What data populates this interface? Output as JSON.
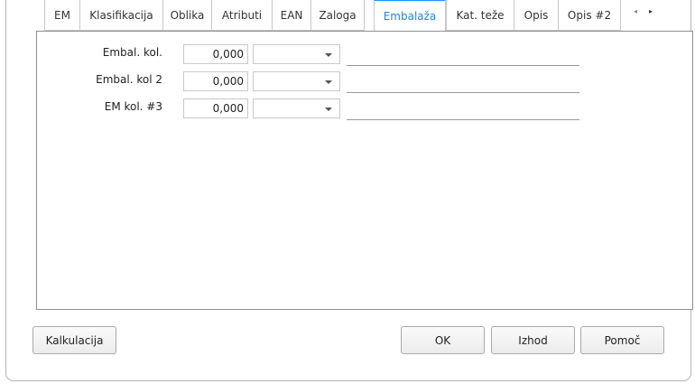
{
  "tabs": [
    {
      "label": "EM"
    },
    {
      "label": "Klasifikacija"
    },
    {
      "label": "Oblika"
    },
    {
      "label": "Atributi"
    },
    {
      "label": "EAN"
    },
    {
      "label": "Zaloga"
    },
    {
      "label": "Embalaža",
      "active": true
    },
    {
      "label": "Kat. teže"
    },
    {
      "label": "Opis"
    },
    {
      "label": "Opis #2"
    }
  ],
  "tab_scroll": {
    "left": "◂",
    "right": "▸"
  },
  "fields": [
    {
      "label": "Embal. kol.",
      "value": "0,000",
      "unit": ""
    },
    {
      "label": "Embal. kol 2",
      "value": "0,000",
      "unit": ""
    },
    {
      "label": "EM kol. #3",
      "value": "0,000",
      "unit": ""
    }
  ],
  "buttons": {
    "kalkulacija": "Kalkulacija",
    "ok": "OK",
    "izhod": "Izhod",
    "pomoc": "Pomoč"
  },
  "colors": {
    "active_tab": "#1a8ad8",
    "active_tab_border": "#1e90ff"
  }
}
